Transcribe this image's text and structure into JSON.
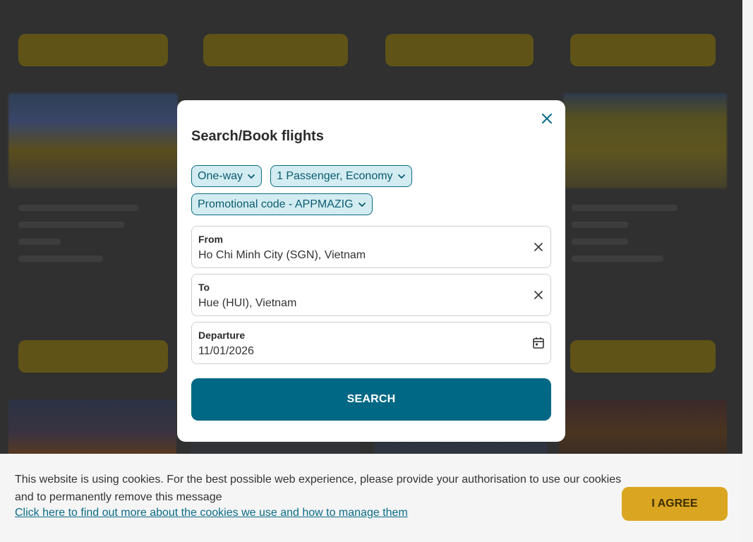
{
  "dialog": {
    "title": "Search/Book flights",
    "trip_type": "One-way",
    "passengers": "1 Passenger, Economy",
    "promo": "Promotional code - APPMAZIG",
    "from": {
      "label": "From",
      "value": "Ho Chi Minh City (SGN), Vietnam"
    },
    "to": {
      "label": "To",
      "value": "Hue (HUI), Vietnam"
    },
    "departure": {
      "label": "Departure",
      "value": "11/01/2026"
    },
    "search_label": "SEARCH"
  },
  "cookie": {
    "text": "This website is using cookies. For the best possible web experience, please provide your authorisation to use our cookies and to permanently remove this message",
    "link": "Click here to find out more about the cookies we use and how to manage them",
    "agree_label": "I AGREE"
  },
  "colors": {
    "primary": "#006885",
    "chip_bg": "#d3ecf1",
    "accent": "#daa520",
    "overlay": "#303030"
  },
  "icons": {
    "close": "close-icon",
    "chevron": "chevron-down-icon",
    "clear": "clear-icon",
    "calendar": "calendar-icon"
  }
}
